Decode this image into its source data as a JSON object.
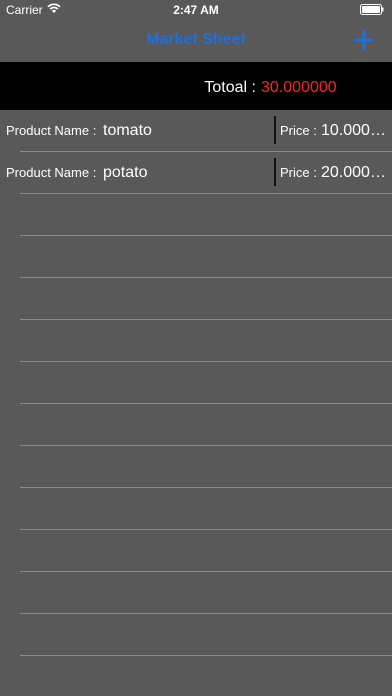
{
  "status_bar": {
    "carrier": "Carrier",
    "time": "2:47 AM"
  },
  "nav": {
    "title": "Market Sheet",
    "add_icon": "plus-icon"
  },
  "summary": {
    "total_label": "Totoal :",
    "total_value": "30.000000"
  },
  "products": [
    {
      "name_label": "Product Name :",
      "name": "tomato",
      "price_label": "Price :",
      "price": "10.000000"
    },
    {
      "name_label": "Product Name :",
      "name": "potato",
      "price_label": "Price :",
      "price": "20.000000"
    }
  ],
  "colors": {
    "background": "#595959",
    "accent": "#1f6fe0",
    "total_value": "#ff2020",
    "total_bar": "#000000"
  }
}
